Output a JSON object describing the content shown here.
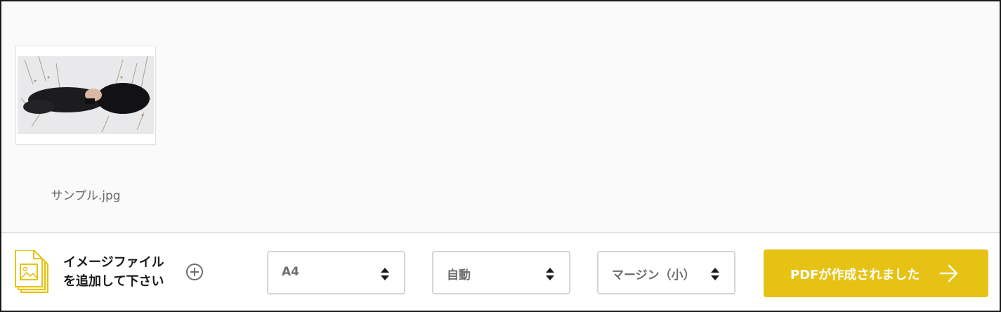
{
  "files": [
    {
      "name": "サンプル.jpg",
      "thumbnail_icon": "portrait-photo-icon"
    }
  ],
  "toolbar": {
    "add_icon": "image-file-icon",
    "add_label_line1": "イメージファイル",
    "add_label_line2": "を追加して下さい",
    "plus_icon": "add-circle-icon",
    "page_size": "A4",
    "orientation": "自動",
    "margin": "マージン（小）",
    "create_label": "PDFが作成されました",
    "create_arrow_icon": "arrow-right-icon"
  },
  "colors": {
    "accent": "#e6c215",
    "border": "#d5d5d5",
    "text": "#1a1a1a",
    "muted": "#6e6e6e"
  }
}
